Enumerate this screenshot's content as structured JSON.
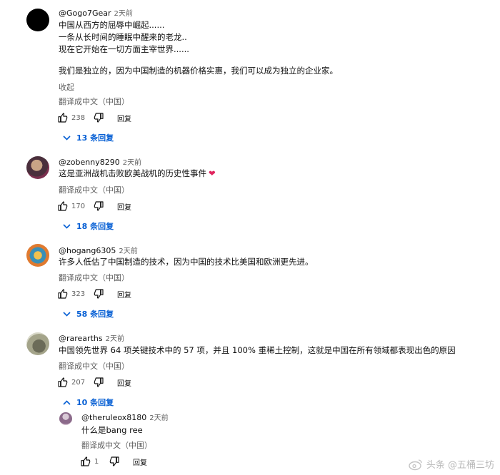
{
  "comments": [
    {
      "author": "@Gogo7Gear",
      "time": "2天前",
      "lines": [
        "中国从西方的屈辱中崛起......",
        "一条从长时间的睡眠中醒来的老龙..",
        "现在它开始在一切方面主宰世界......"
      ],
      "lines2": [
        "我们是独立的，因为中国制造的机器价格实惠，我们可以成为独立的企业家。"
      ],
      "collapse": "收起",
      "translate": "翻译成中文（中国）",
      "likes": "238",
      "reply": "回复",
      "replies": "13 条回复"
    },
    {
      "author": "@zobenny8290",
      "time": "2天前",
      "lines": [
        "这是亚洲战机击败欧美战机的历史性事件"
      ],
      "heart": "❤",
      "translate": "翻译成中文（中国）",
      "likes": "170",
      "reply": "回复",
      "replies": "18 条回复"
    },
    {
      "author": "@hogang6305",
      "time": "2天前",
      "lines": [
        "许多人低估了中国制造的技术，因为中国的技术比美国和欧洲更先进。"
      ],
      "translate": "翻译成中文（中国）",
      "likes": "323",
      "reply": "回复",
      "replies": "58 条回复"
    },
    {
      "author": "@rarearths",
      "time": "2天前",
      "lines": [
        "中国领先世界 64 项关键技术中的 57 项，并且 100% 重稀土控制，这就是中国在所有领域都表现出色的原因"
      ],
      "translate": "翻译成中文（中国）",
      "likes": "207",
      "reply": "回复",
      "replies": "10 条回复"
    }
  ],
  "nested_reply": {
    "author": "@theruleox8180",
    "time": "2天前",
    "text": "什么是bang ree",
    "translate": "翻译成中文（中国）",
    "likes": "1",
    "reply": "回复"
  },
  "watermark": "头条 @五桶三坊",
  "colors": {
    "link_blue": "#065fd4",
    "heart_red": "#e0245e",
    "meta_grey": "#606060"
  },
  "icons": [
    "thumb-up-icon",
    "thumb-down-icon",
    "chevron-down-icon",
    "chevron-up-icon",
    "weibo-icon"
  ]
}
